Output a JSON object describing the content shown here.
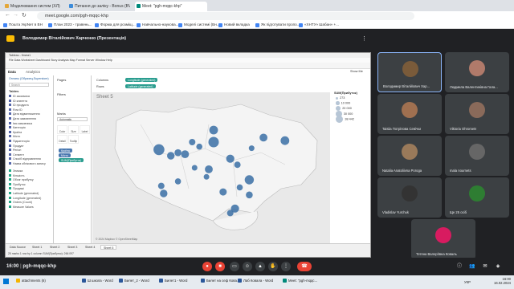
{
  "tabs": [
    {
      "label": "Моделювання систем (ХЛ)",
      "color": "#e4a73a"
    },
    {
      "label": "Питання до заліку - Bonus (BV-ch)",
      "color": "#3c8bd9"
    },
    {
      "label": "Meet: \"pgh-mqqc-khp\"",
      "color": "#00897b",
      "active": true
    }
  ],
  "address": {
    "url": "meet.google.com/pgh-mqqc-khp"
  },
  "bookmarks": [
    {
      "label": "Пошта УкрNет в ВН"
    },
    {
      "label": "План 2023 - травень..."
    },
    {
      "label": "Форма для розміщ..."
    },
    {
      "label": "Навчально-наукова..."
    },
    {
      "label": "Моделі системі (Вн..."
    },
    {
      "label": "Новий вкладка"
    },
    {
      "label": "Як підготувати пропо..."
    },
    {
      "label": "«ХНТУ» Шабан» +..."
    }
  ],
  "meet": {
    "presenter_label": "Володимир Віталійович Харченко (Презентація)",
    "meeting_code": "pgh-mqqc-khp",
    "time": "16:00"
  },
  "tableau": {
    "window_title": "Tableau - Книга1",
    "menu": "File  Data  Worksheet  Dashboard  Story  Analysis  Map  Format  Server  Window  Help",
    "data_tab": "Data",
    "analytics_tab": "Analytics",
    "datasource": "Оплаты (Образец-Superstore)",
    "search_placeholder": "Search",
    "tables_header": "Tables",
    "fields": [
      "ID заказчика",
      "ID клиента",
      "ID продукта",
      "Row ID",
      "Дата відвантаження",
      "Дата замовлення",
      "Імя замовника",
      "Категорія",
      "Країна",
      "Місто",
      "Підкатегорія",
      "Продукт",
      "Регіон",
      "Сегмент",
      "Спосіб відправлення",
      "Назва облікового запису"
    ],
    "measures": [
      "Знижка",
      "Кількість",
      "Обсяг прибутку",
      "Прибуток",
      "Продажі",
      "Latitude (generated)",
      "Longitude (generated)",
      "Orders (Count)",
      "Measure Values"
    ],
    "pages_label": "Pages",
    "filters_label": "Filters",
    "marks_label": "Marks",
    "marks_type": "Automatic",
    "marks_buttons": [
      "Color",
      "Size",
      "Label",
      "Detail",
      "Tooltip"
    ],
    "shelf_pills": [
      "Країна",
      "Місто",
      "SUM(Прибуток)"
    ],
    "columns_label": "Columns",
    "rows_label": "Rows",
    "columns_pill": "Longitude (generated)",
    "rows_pill": "Latitude (generated)",
    "sheet_title": "Sheet 5",
    "show_me": "Show Me",
    "legend_title": "SUM(Прибуток)",
    "legend_items": [
      "273",
      "10 000",
      "20 000",
      "30 000",
      "38 442"
    ],
    "map_credit": "© 2024 Mapbox © OpenStreetMap",
    "sheet_tabs": [
      "Data Source",
      "Sheet 1",
      "Sheet 2",
      "Sheet 3",
      "Sheet 4",
      "Sheet 5"
    ],
    "status": "25 marks   1 row by 1 column   SUM(Прибуток): 266 097"
  },
  "chart_data": {
    "type": "scatter",
    "title": "Sheet 5",
    "size_legend": {
      "title": "SUM(Прибуток)",
      "values": [
        273,
        10000,
        20000,
        30000,
        38442
      ]
    },
    "points": [
      {
        "x": 0.28,
        "y": 0.38,
        "v": 22000
      },
      {
        "x": 0.33,
        "y": 0.42,
        "v": 8000
      },
      {
        "x": 0.36,
        "y": 0.4,
        "v": 6000
      },
      {
        "x": 0.39,
        "y": 0.41,
        "v": 9000
      },
      {
        "x": 0.42,
        "y": 0.33,
        "v": 5000
      },
      {
        "x": 0.51,
        "y": 0.33,
        "v": 20000
      },
      {
        "x": 0.51,
        "y": 0.25,
        "v": 12000
      },
      {
        "x": 0.45,
        "y": 0.36,
        "v": 4000
      },
      {
        "x": 0.58,
        "y": 0.44,
        "v": 10000
      },
      {
        "x": 0.61,
        "y": 0.48,
        "v": 5000
      },
      {
        "x": 0.72,
        "y": 0.3,
        "v": 9000
      },
      {
        "x": 0.81,
        "y": 0.32,
        "v": 12000
      },
      {
        "x": 0.66,
        "y": 0.58,
        "v": 14000
      },
      {
        "x": 0.49,
        "y": 0.51,
        "v": 9000
      },
      {
        "x": 0.48,
        "y": 0.56,
        "v": 3000
      },
      {
        "x": 0.55,
        "y": 0.66,
        "v": 7000
      },
      {
        "x": 0.3,
        "y": 0.67,
        "v": 8000
      },
      {
        "x": 0.36,
        "y": 0.59,
        "v": 4000
      },
      {
        "x": 0.6,
        "y": 0.77,
        "v": 10000
      },
      {
        "x": 0.66,
        "y": 0.68,
        "v": 6000
      },
      {
        "x": 0.67,
        "y": 0.37,
        "v": 3000
      },
      {
        "x": 0.62,
        "y": 0.63,
        "v": 4000
      },
      {
        "x": 0.58,
        "y": 0.8,
        "v": 5000
      },
      {
        "x": 0.29,
        "y": 0.62,
        "v": 5000
      },
      {
        "x": 0.43,
        "y": 0.5,
        "v": 3000
      }
    ]
  },
  "participants": [
    {
      "name": "Володимир Віталійович Хар...",
      "initial": "В",
      "color": "#7a5b3a",
      "me": true
    },
    {
      "name": "Людмила Валентинівна Гала...",
      "initial": "Л",
      "color": "#b07a6a"
    },
    {
      "name": "Taisiia Потріпова Севічка",
      "initial": "T",
      "color": "#a07050"
    },
    {
      "name": "Viktoria Ohromets",
      "initial": "V",
      "color": "#8a6a5a"
    },
    {
      "name": "Natalia Anatoliivna Poroga",
      "initial": "N",
      "color": "#9a7a5a"
    },
    {
      "name": "mala nournets",
      "initial": "m",
      "color": "#666"
    },
    {
      "name": "Vladislav Yurchuk",
      "initial": "V",
      "color": "#333"
    },
    {
      "name": "Ще 25 осіб",
      "initial": "Г",
      "color": "#2e7d32"
    },
    {
      "name": "Тетяна Валеріївна Коваль",
      "initial": "Т",
      "color": "#d81b60"
    }
  ],
  "taskbar": [
    {
      "label": "attachments (6)",
      "color": "#f4b400"
    },
    {
      "label": "Ш школа - Word",
      "color": "#2b579a"
    },
    {
      "label": "Билет_2 - Word",
      "color": "#2b579a"
    },
    {
      "label": "Билет1 - Word",
      "color": "#2b579a"
    },
    {
      "label": "Билет на сеф Кова...",
      "color": "#2b579a"
    },
    {
      "label": "Лаб Ковала - Word",
      "color": "#2b579a"
    },
    {
      "label": "Meet: \"pgh-mqqc...",
      "color": "#00897b"
    }
  ],
  "tray": {
    "time": "16:00",
    "date": "16.02.2024",
    "lang": "УКР"
  }
}
